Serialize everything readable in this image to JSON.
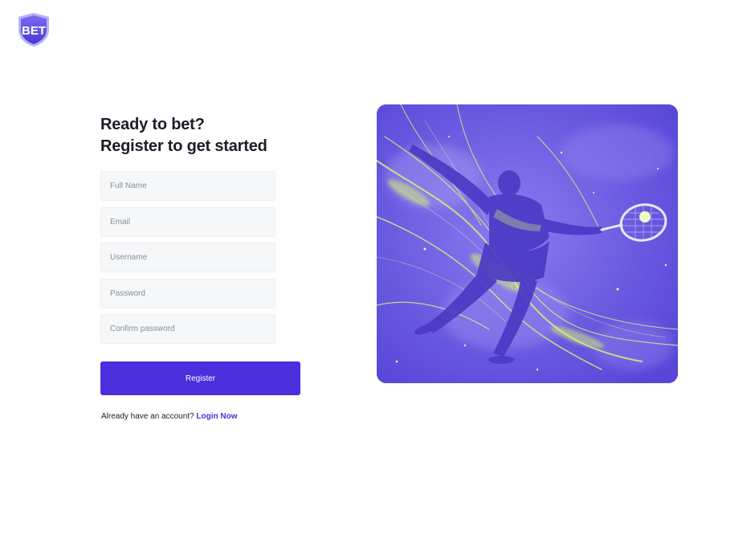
{
  "logo": {
    "text": "BET",
    "icon": "shield-logo"
  },
  "heading": {
    "line1": "Ready to bet?",
    "line2": "Register to get started"
  },
  "form": {
    "full_name": {
      "placeholder": "Full Name",
      "value": ""
    },
    "email": {
      "placeholder": "Email",
      "value": ""
    },
    "username": {
      "placeholder": "Username",
      "value": ""
    },
    "password": {
      "placeholder": "Password",
      "value": ""
    },
    "confirm_password": {
      "placeholder": "Confirm password",
      "value": ""
    },
    "submit_label": "Register"
  },
  "footer": {
    "prompt": "Already have an account?",
    "login_label": "Login Now"
  },
  "hero": {
    "image": "tennis-player-illustration"
  },
  "colors": {
    "accent": "#4b2fdc",
    "hero_base": "#6a5ae0",
    "hero_highlight": "#d4f27a",
    "input_bg": "#f6f7f9"
  }
}
